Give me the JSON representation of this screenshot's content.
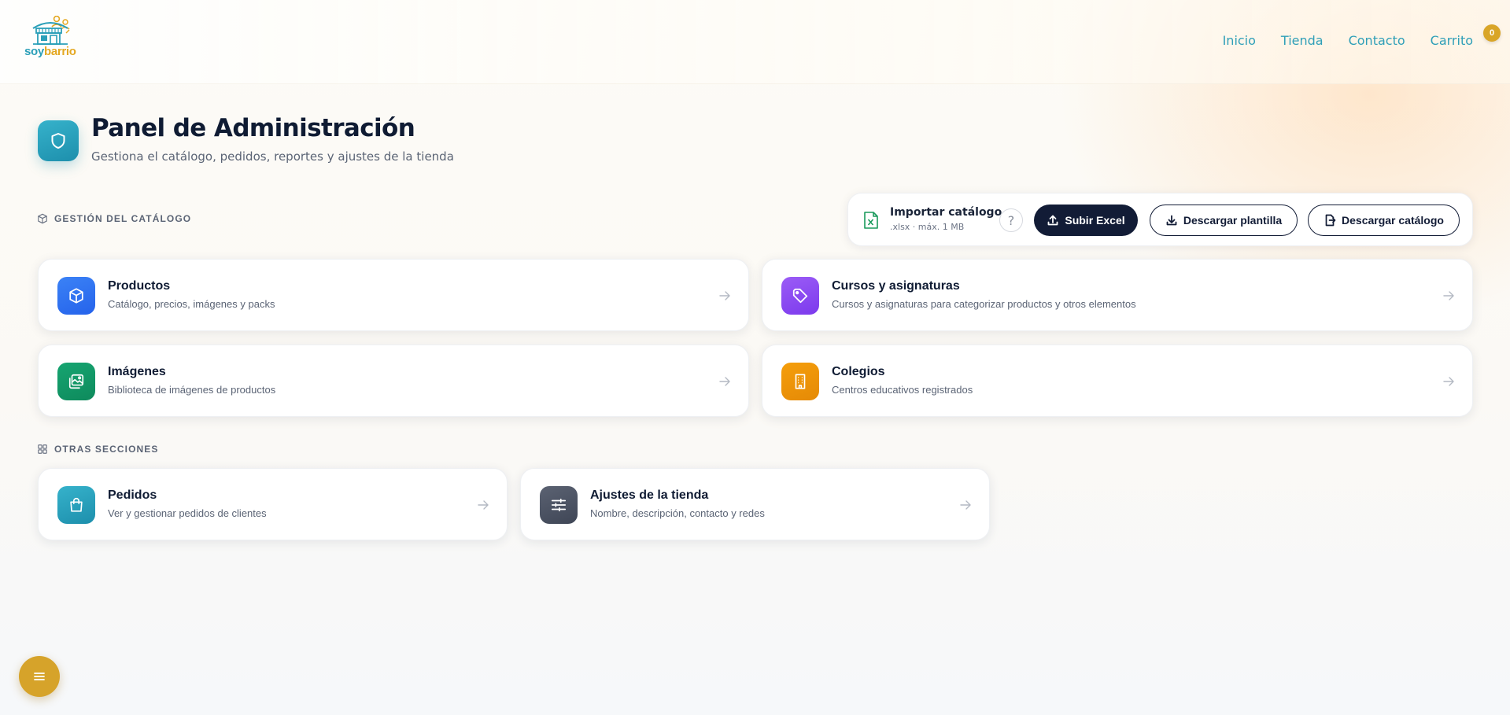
{
  "brand": {
    "part1": "soy",
    "part2": "barrio"
  },
  "nav": {
    "items": [
      {
        "label": "Inicio"
      },
      {
        "label": "Tienda"
      },
      {
        "label": "Contacto"
      },
      {
        "label": "Carrito"
      }
    ],
    "cart_count": "0"
  },
  "page": {
    "title": "Panel de Administración",
    "subtitle": "Gestiona el catálogo, pedidos, reportes y ajustes de la tienda"
  },
  "sections": {
    "catalog": "GESTIÓN DEL CATÁLOGO",
    "other": "OTRAS SECCIONES"
  },
  "import": {
    "title": "Importar catálogo",
    "hint": ".xlsx · máx. 1 MB",
    "help": "?",
    "upload_label": "Subir Excel",
    "template_label": "Descargar plantilla",
    "catalog_label": "Descargar catálogo"
  },
  "catalog_cards": [
    {
      "title": "Productos",
      "desc": "Catálogo, precios, imágenes y packs",
      "icon": "box-icon",
      "color": "#2563eb"
    },
    {
      "title": "Cursos y asignaturas",
      "desc": "Cursos y asignaturas para categorizar productos y otros elementos",
      "icon": "tag-icon",
      "color": "#7c3aed"
    },
    {
      "title": "Imágenes",
      "desc": "Biblioteca de imágenes de productos",
      "icon": "images-icon",
      "color": "#0e8a5c"
    },
    {
      "title": "Colegios",
      "desc": "Centros educativos registrados",
      "icon": "building-icon",
      "color": "#e58a06"
    }
  ],
  "other_cards": [
    {
      "title": "Pedidos",
      "desc": "Ver y gestionar pedidos de clientes",
      "icon": "shopping-bag-icon",
      "color": "#1d8fac"
    },
    {
      "title": "Ajustes de la tienda",
      "desc": "Nombre, descripción, contacto y redes",
      "icon": "sliders-icon",
      "color": "#3f4656"
    }
  ],
  "colors": {
    "accent": "#2f9fb8",
    "brand_gold": "#d6a32a",
    "dark_button": "#121c36"
  }
}
